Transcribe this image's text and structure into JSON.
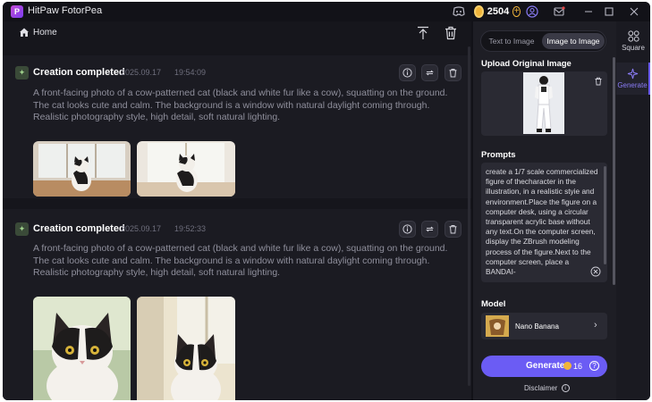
{
  "app": {
    "title": "HitPaw FotorPea",
    "credits": "2504"
  },
  "toolbar": {
    "home_label": "Home"
  },
  "cards": [
    {
      "title": "Creation completed",
      "date": "2025.09.17",
      "time": "19:54:09",
      "prompt": "A front-facing photo of a cow-patterned cat (black and white fur like a cow), squatting on the ground. The cat looks cute and calm. The background is a window with natural daylight coming through. Realistic photography style, high detail, soft natural lighting."
    },
    {
      "title": "Creation completed",
      "date": "2025.09.17",
      "time": "19:52:33",
      "prompt": "A front-facing photo of a cow-patterned cat (black and white fur like a cow), squatting on the ground. The cat looks cute and calm. The background is a window with natural daylight coming through. Realistic photography style, high detail, soft natural lighting."
    }
  ],
  "panel": {
    "tabs": [
      "Text to Image",
      "Image to Image"
    ],
    "active_tab": "Image to Image",
    "upload_title": "Upload Original Image",
    "prompts_title": "Prompts",
    "prompt_value": "create a 1/7 scale commercialized figure of thecharacter in the illustration, in a realistic styie and environment.Place the figure on a computer desk, using a circular transparent acrylic base without any text.On the computer screen, display the ZBrush modeling process of the figure.Next to the computer screen, place a BANDAI-",
    "model_title": "Model",
    "model_name": "Nano Banana",
    "generate_label": "Generate",
    "generate_cost": "16",
    "disclaimer": "Disclaimer"
  },
  "nav": {
    "square_label": "Square",
    "generate_label": "Generate"
  },
  "colors": {
    "accent": "#6b5cf4",
    "coin": "#f0b43a",
    "bg": "#121218"
  }
}
